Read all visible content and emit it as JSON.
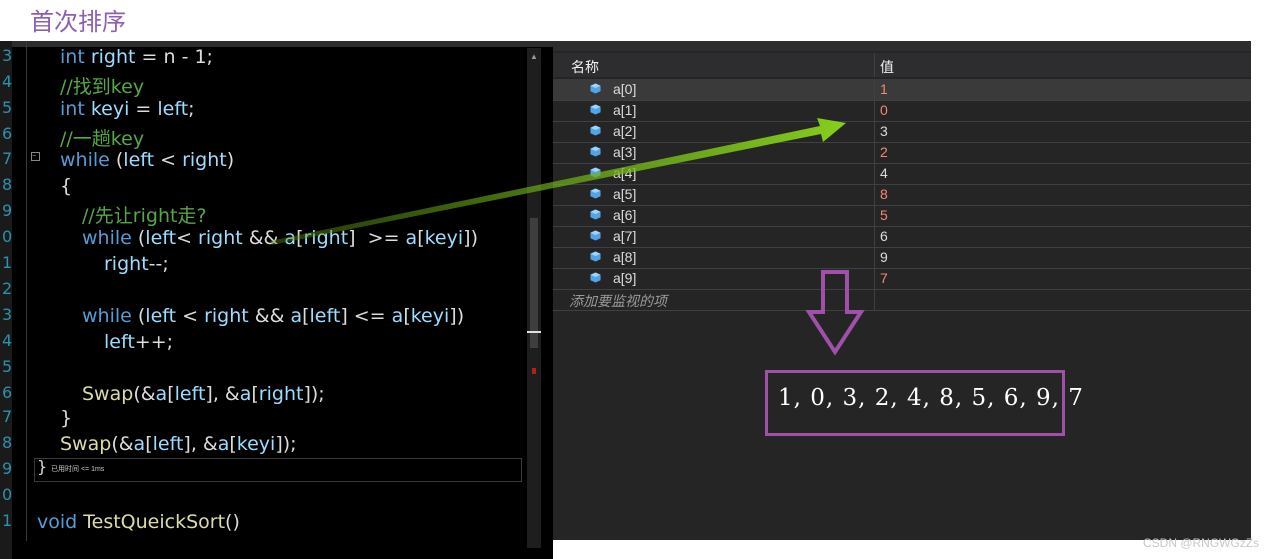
{
  "heading": "首次排序",
  "editor": {
    "line_numbers": [
      "3",
      "4",
      "5",
      "6",
      "7",
      "8",
      "9",
      "0",
      "1",
      "2",
      "3",
      "4",
      "5",
      "6",
      "7",
      "8",
      "9",
      "0",
      "1"
    ],
    "perf_tip": "已用时间 <= 1ms",
    "lines": {
      "l1_kw": "int",
      "l1_var": "right",
      "l1_rest": " = n - 1;",
      "l2": "//找到key",
      "l3_kw": "int",
      "l3_var": "keyi",
      "l3_eq": " = ",
      "l3_var2": "left",
      "l3_end": ";",
      "l4": "//一趟key",
      "l5_kw": "while",
      "l5_p1": " (",
      "l5_v1": "left",
      "l5_op": " < ",
      "l5_v2": "right",
      "l5_p2": ")",
      "l6": "{",
      "l7": "//先让right走?",
      "l8_kw": "while",
      "l8_p1": " (",
      "l8_v1": "left",
      "l8_op": "< ",
      "l8_v2": "right",
      "l8_and": " && ",
      "l8_a": "a",
      "l8_b1": "[",
      "l8_v3": "right",
      "l8_b2": "]  >= ",
      "l8_a2": "a",
      "l8_b3": "[",
      "l8_v4": "keyi",
      "l8_b4": "])",
      "l9_v": "right",
      "l9_op": "--;",
      "l10_kw": "while",
      "l10_p1": " (",
      "l10_v1": "left",
      "l10_op": " < ",
      "l10_v2": "right",
      "l10_and": " && ",
      "l10_a": "a",
      "l10_b1": "[",
      "l10_v3": "left",
      "l10_b2": "] <= ",
      "l10_a2": "a",
      "l10_b3": "[",
      "l10_v4": "keyi",
      "l10_b4": "])",
      "l11_v": "left",
      "l11_op": "++;",
      "l12_fn": "Swap",
      "l12_p1": "(&",
      "l12_a": "a",
      "l12_b1": "[",
      "l12_v1": "left",
      "l12_b2": "], &",
      "l12_a2": "a",
      "l12_b3": "[",
      "l12_v2": "right",
      "l12_b4": "]);",
      "l13": "}",
      "l14_fn": "Swap",
      "l14_p1": "(&",
      "l14_a": "a",
      "l14_b1": "[",
      "l14_v1": "left",
      "l14_b2": "], &",
      "l14_a2": "a",
      "l14_b3": "[",
      "l14_v2": "keyi",
      "l14_b4": "]);",
      "l15": "}",
      "l16_kw": "void",
      "l16_fn": "TestQueickSort",
      "l16_p": "()"
    }
  },
  "watch": {
    "col_name": "名称",
    "col_value": "值",
    "rows": [
      {
        "name": "a[0]",
        "value": "1",
        "changed": true
      },
      {
        "name": "a[1]",
        "value": "0",
        "changed": true
      },
      {
        "name": "a[2]",
        "value": "3",
        "changed": false
      },
      {
        "name": "a[3]",
        "value": "2",
        "changed": true
      },
      {
        "name": "a[4]",
        "value": "4",
        "changed": false
      },
      {
        "name": "a[5]",
        "value": "8",
        "changed": true
      },
      {
        "name": "a[6]",
        "value": "5",
        "changed": true
      },
      {
        "name": "a[7]",
        "value": "6",
        "changed": false
      },
      {
        "name": "a[8]",
        "value": "9",
        "changed": false
      },
      {
        "name": "a[9]",
        "value": "7",
        "changed": true
      }
    ],
    "add_placeholder": "添加要监视的项",
    "changed_color": "#f48771",
    "unchanged_color": "#dcdcdc"
  },
  "annotation": {
    "sequence": "1, 0, 3, 2, 4, 8, 5, 6, 9, 7",
    "arrow_color": "#7cc41f",
    "box_color": "#a050a8"
  },
  "watermark": "CSDN @RNGWGzZs"
}
